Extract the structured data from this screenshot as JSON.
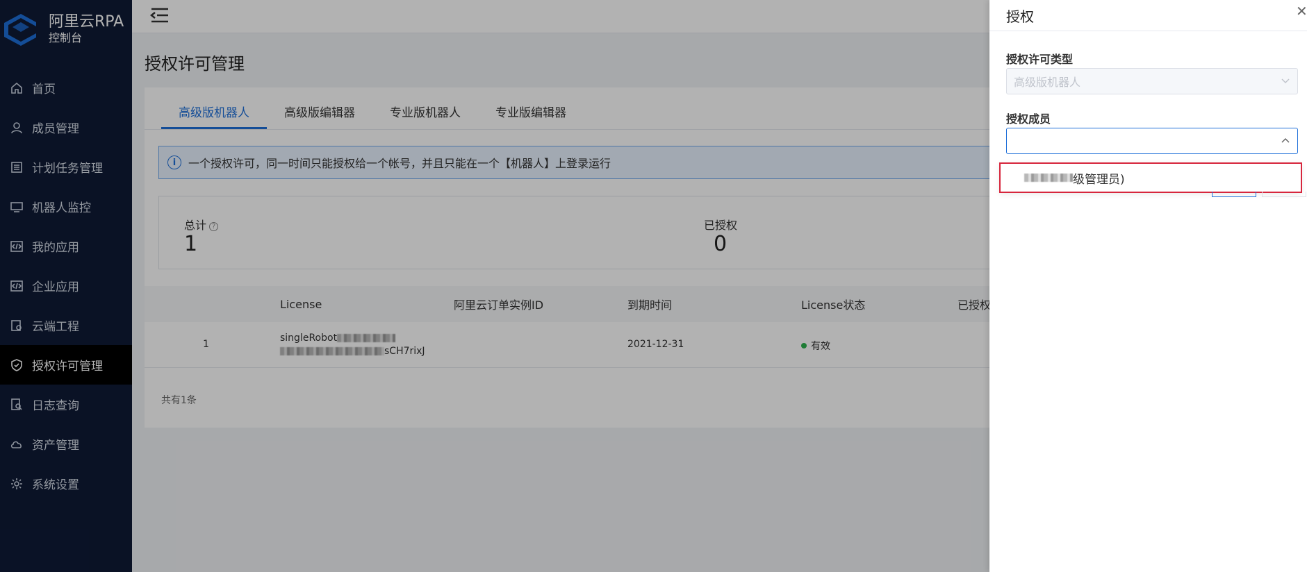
{
  "app": {
    "title": "阿里云RPA",
    "subtitle": "控制台"
  },
  "sidebar": {
    "items": [
      {
        "label": "首页",
        "icon": "home-icon"
      },
      {
        "label": "成员管理",
        "icon": "user-icon"
      },
      {
        "label": "计划任务管理",
        "icon": "list-icon"
      },
      {
        "label": "机器人监控",
        "icon": "monitor-icon"
      },
      {
        "label": "我的应用",
        "icon": "code-icon"
      },
      {
        "label": "企业应用",
        "icon": "code-icon"
      },
      {
        "label": "云端工程",
        "icon": "cloud-project-icon"
      },
      {
        "label": "授权许可管理",
        "icon": "shield-check-icon"
      },
      {
        "label": "日志查询",
        "icon": "log-search-icon"
      },
      {
        "label": "资产管理",
        "icon": "cloud-icon"
      },
      {
        "label": "系统设置",
        "icon": "gear-icon"
      }
    ],
    "active_index": 7
  },
  "page": {
    "title": "授权许可管理"
  },
  "tabs": [
    "高级版机器人",
    "高级版编辑器",
    "专业版机器人",
    "专业版编辑器"
  ],
  "alert": {
    "text": "一个授权许可，同一时间只能授权给一个帐号，并且只能在一个【机器人】上登录运行"
  },
  "stats": {
    "total_label": "总计",
    "total_value": "1",
    "authorized_label": "已授权",
    "authorized_value": "0"
  },
  "table": {
    "columns": [
      "License",
      "阿里云订单实例ID",
      "到期时间",
      "License状态",
      "已授权"
    ],
    "rows": [
      {
        "index": "1",
        "license_line1": "singleRobot",
        "license_line2_suffix": "sCH7rixJ",
        "expire": "2021-12-31",
        "status": "有效"
      }
    ],
    "footer": "共有1条"
  },
  "drawer": {
    "title": "授权",
    "type_label": "授权许可类型",
    "type_value": "高级版机器人",
    "member_label": "授权成员",
    "member_value": "",
    "option_suffix": "级管理员)"
  },
  "colors": {
    "sidebar_bg": "#0f1a36",
    "accent": "#1e6fd9",
    "highlight": "#d7263d",
    "status_ok": "#2bb24c"
  }
}
